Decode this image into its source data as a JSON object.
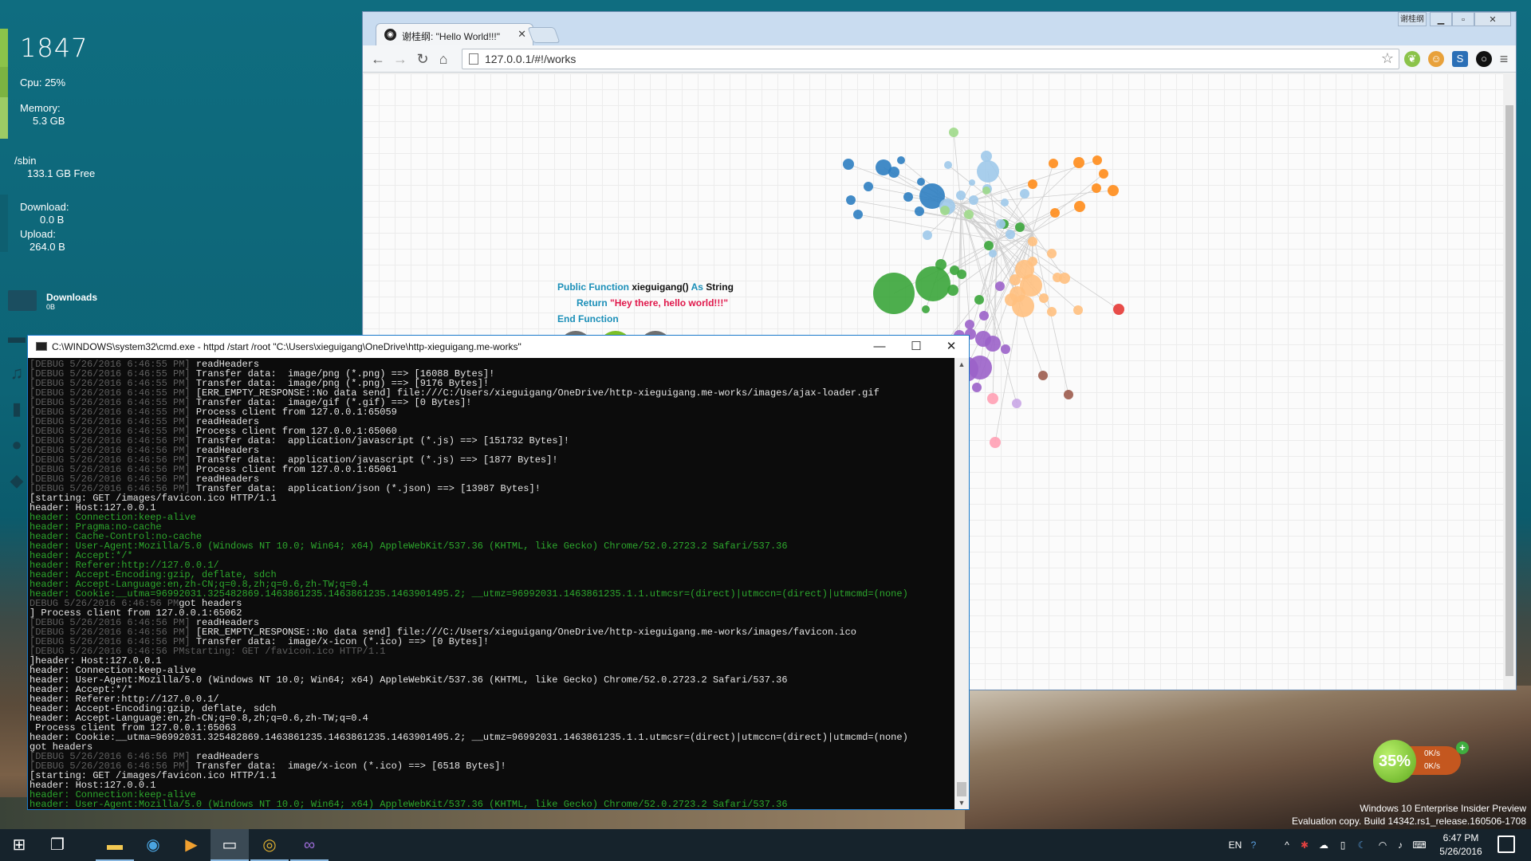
{
  "desktop": {
    "widget": {
      "time": "1847",
      "cpu": "Cpu:  25%",
      "memory_label": "Memory:",
      "memory_value": "5.3 GB",
      "disk_label": "/sbin",
      "disk_value": "133.1 GB Free",
      "download_label": "Download:",
      "download_value": "0.0 B",
      "upload_label": "Upload:",
      "upload_value": "264.0 B"
    },
    "downloads_folder": {
      "label": "Downloads",
      "sub": "0B"
    },
    "side_icons": [
      "folder-icon",
      "music-icon",
      "document-icon",
      "user-icon",
      "gamepad-icon"
    ],
    "net_speed": {
      "percent": "35%",
      "up": "0K/s",
      "down": "0K/s"
    },
    "watermark": {
      "line1": "Windows 10 Enterprise Insider Preview",
      "line2": "Evaluation copy. Build 14342.rs1_release.160506-1708"
    }
  },
  "chrome": {
    "tab_title": "谢桂纲: \"Hello World!!!\"",
    "title_corner": "谢桂纲",
    "url": "127.0.0.1/#!/works",
    "code": {
      "line1_kw1": "Public Function",
      "line1_name": "xieguigang()",
      "line1_kw2": "As",
      "line1_type": "String",
      "line2_kw": "Return",
      "line2_str": "\"Hey there, hello world!!!\"",
      "line3": "End Function"
    },
    "colors": {
      "accent_blue": "#1b8fb8",
      "string_red": "#e0184b"
    }
  },
  "cmd": {
    "title": "C:\\WINDOWS\\system32\\cmd.exe - httpd  /start /root \"C:\\Users\\xieguigang\\OneDrive\\http-xieguigang.me-works\"",
    "lines": [
      {
        "t": "d",
        "p": "[DEBUG 5/26/2016 6:46:55 PM]",
        "s": " readHeaders"
      },
      {
        "t": "d",
        "p": "[DEBUG 5/26/2016 6:46:55 PM]",
        "s": " Transfer data:  image/png (*.png) ==> [16088 Bytes]!"
      },
      {
        "t": "d",
        "p": "[DEBUG 5/26/2016 6:46:55 PM]",
        "s": " Transfer data:  image/png (*.png) ==> [9176 Bytes]!"
      },
      {
        "t": "d",
        "p": "[DEBUG 5/26/2016 6:46:55 PM]",
        "s": " [ERR_EMPTY_RESPONSE::No data send] file:///C:/Users/xieguigang/OneDrive/http-xieguigang.me-works/images/ajax-loader.gif"
      },
      {
        "t": "d",
        "p": "[DEBUG 5/26/2016 6:46:55 PM]",
        "s": " Transfer data:  image/gif (*.gif) ==> [0 Bytes]!"
      },
      {
        "t": "d",
        "p": "[DEBUG 5/26/2016 6:46:55 PM]",
        "s": " Process client from 127.0.0.1:65059"
      },
      {
        "t": "d",
        "p": "[DEBUG 5/26/2016 6:46:55 PM]",
        "s": " readHeaders"
      },
      {
        "t": "d",
        "p": "[DEBUG 5/26/2016 6:46:55 PM]",
        "s": " Process client from 127.0.0.1:65060"
      },
      {
        "t": "d",
        "p": "[DEBUG 5/26/2016 6:46:56 PM]",
        "s": " Transfer data:  application/javascript (*.js) ==> [151732 Bytes]!"
      },
      {
        "t": "d",
        "p": "[DEBUG 5/26/2016 6:46:56 PM]",
        "s": " readHeaders"
      },
      {
        "t": "d",
        "p": "[DEBUG 5/26/2016 6:46:56 PM]",
        "s": " Transfer data:  application/javascript (*.js) ==> [1877 Bytes]!"
      },
      {
        "t": "d",
        "p": "[DEBUG 5/26/2016 6:46:56 PM]",
        "s": " Process client from 127.0.0.1:65061"
      },
      {
        "t": "d",
        "p": "[DEBUG 5/26/2016 6:46:56 PM]",
        "s": " readHeaders"
      },
      {
        "t": "d",
        "p": "[DEBUG 5/26/2016 6:46:56 PM]",
        "s": " Transfer data:  application/json (*.json) ==> [13987 Bytes]!"
      },
      {
        "t": "w",
        "p": "",
        "s": "[starting: GET /images/favicon.ico HTTP/1.1"
      },
      {
        "t": "w",
        "p": "",
        "s": "header: Host:127.0.0.1"
      },
      {
        "t": "g",
        "p": "",
        "s": "header: Connection:keep-alive"
      },
      {
        "t": "g",
        "p": "",
        "s": "header: Pragma:no-cache"
      },
      {
        "t": "g",
        "p": "",
        "s": "header: Cache-Control:no-cache"
      },
      {
        "t": "g",
        "p": "",
        "s": "header: User-Agent:Mozilla/5.0 (Windows NT 10.0; Win64; x64) AppleWebKit/537.36 (KHTML, like Gecko) Chrome/52.0.2723.2 Safari/537.36"
      },
      {
        "t": "g",
        "p": "",
        "s": "header: Accept:*/*"
      },
      {
        "t": "g",
        "p": "",
        "s": "header: Referer:http://127.0.0.1/"
      },
      {
        "t": "g",
        "p": "",
        "s": "header: Accept-Encoding:gzip, deflate, sdch"
      },
      {
        "t": "g",
        "p": "",
        "s": "header: Accept-Language:en,zh-CN;q=0.8,zh;q=0.6,zh-TW;q=0.4"
      },
      {
        "t": "g",
        "p": "",
        "s": "header: Cookie:__utma=96992031.325482869.1463861235.1463861235.1463901495.2; __utmz=96992031.1463861235.1.1.utmcsr=(direct)|utmccn=(direct)|utmcmd=(none)"
      },
      {
        "t": "d",
        "p": "DEBUG 5/26/2016 6:46:56 PM",
        "s": "got headers"
      },
      {
        "t": "w",
        "p": "",
        "s": "] Process client from 127.0.0.1:65062"
      },
      {
        "t": "d",
        "p": "[DEBUG 5/26/2016 6:46:56 PM]",
        "s": " readHeaders"
      },
      {
        "t": "d",
        "p": "[DEBUG 5/26/2016 6:46:56 PM]",
        "s": " [ERR_EMPTY_RESPONSE::No data send] file:///C:/Users/xieguigang/OneDrive/http-xieguigang.me-works/images/favicon.ico"
      },
      {
        "t": "d",
        "p": "[DEBUG 5/26/2016 6:46:56 PM]",
        "s": " Transfer data:  image/x-icon (*.ico) ==> [0 Bytes]!"
      },
      {
        "t": "d",
        "p": "[DEBUG 5/26/2016 6:46:56 PMstarting: GET /favicon.ico HTTP/1.1",
        "s": ""
      },
      {
        "t": "w",
        "p": "",
        "s": "]header: Host:127.0.0.1"
      },
      {
        "t": "w",
        "p": "",
        "s": "header: Connection:keep-alive"
      },
      {
        "t": "w",
        "p": "",
        "s": "header: User-Agent:Mozilla/5.0 (Windows NT 10.0; Win64; x64) AppleWebKit/537.36 (KHTML, like Gecko) Chrome/52.0.2723.2 Safari/537.36"
      },
      {
        "t": "w",
        "p": "",
        "s": "header: Accept:*/*"
      },
      {
        "t": "w",
        "p": "",
        "s": "header: Referer:http://127.0.0.1/"
      },
      {
        "t": "w",
        "p": "",
        "s": "header: Accept-Encoding:gzip, deflate, sdch"
      },
      {
        "t": "w",
        "p": "",
        "s": "header: Accept-Language:en,zh-CN;q=0.8,zh;q=0.6,zh-TW;q=0.4"
      },
      {
        "t": "w",
        "p": "",
        "s": " Process client from 127.0.0.1:65063"
      },
      {
        "t": "w",
        "p": "",
        "s": "header: Cookie:__utma=96992031.325482869.1463861235.1463861235.1463901495.2; __utmz=96992031.1463861235.1.1.utmcsr=(direct)|utmccn=(direct)|utmcmd=(none)"
      },
      {
        "t": "w",
        "p": "",
        "s": "got headers"
      },
      {
        "t": "d",
        "p": "[DEBUG 5/26/2016 6:46:56 PM]",
        "s": " readHeaders"
      },
      {
        "t": "d",
        "p": "[DEBUG 5/26/2016 6:46:56 PM]",
        "s": " Transfer data:  image/x-icon (*.ico) ==> [6518 Bytes]!"
      },
      {
        "t": "w",
        "p": "",
        "s": "[starting: GET /images/favicon.ico HTTP/1.1"
      },
      {
        "t": "w",
        "p": "",
        "s": "header: Host:127.0.0.1"
      },
      {
        "t": "g",
        "p": "",
        "s": "header: Connection:keep-alive"
      },
      {
        "t": "g",
        "p": "",
        "s": "header: User-Agent:Mozilla/5.0 (Windows NT 10.0; Win64; x64) AppleWebKit/537.36 (KHTML, like Gecko) Chrome/52.0.2723.2 Safari/537.36"
      }
    ]
  },
  "taskbar": {
    "apps": [
      "start-icon",
      "task-view-icon",
      "file-explorer-icon",
      "browser-icon",
      "media-player-icon",
      "cmd-icon",
      "chrome-icon",
      "visual-studio-icon"
    ],
    "lang": "EN",
    "time": "6:47 PM",
    "date": "5/26/2016"
  }
}
